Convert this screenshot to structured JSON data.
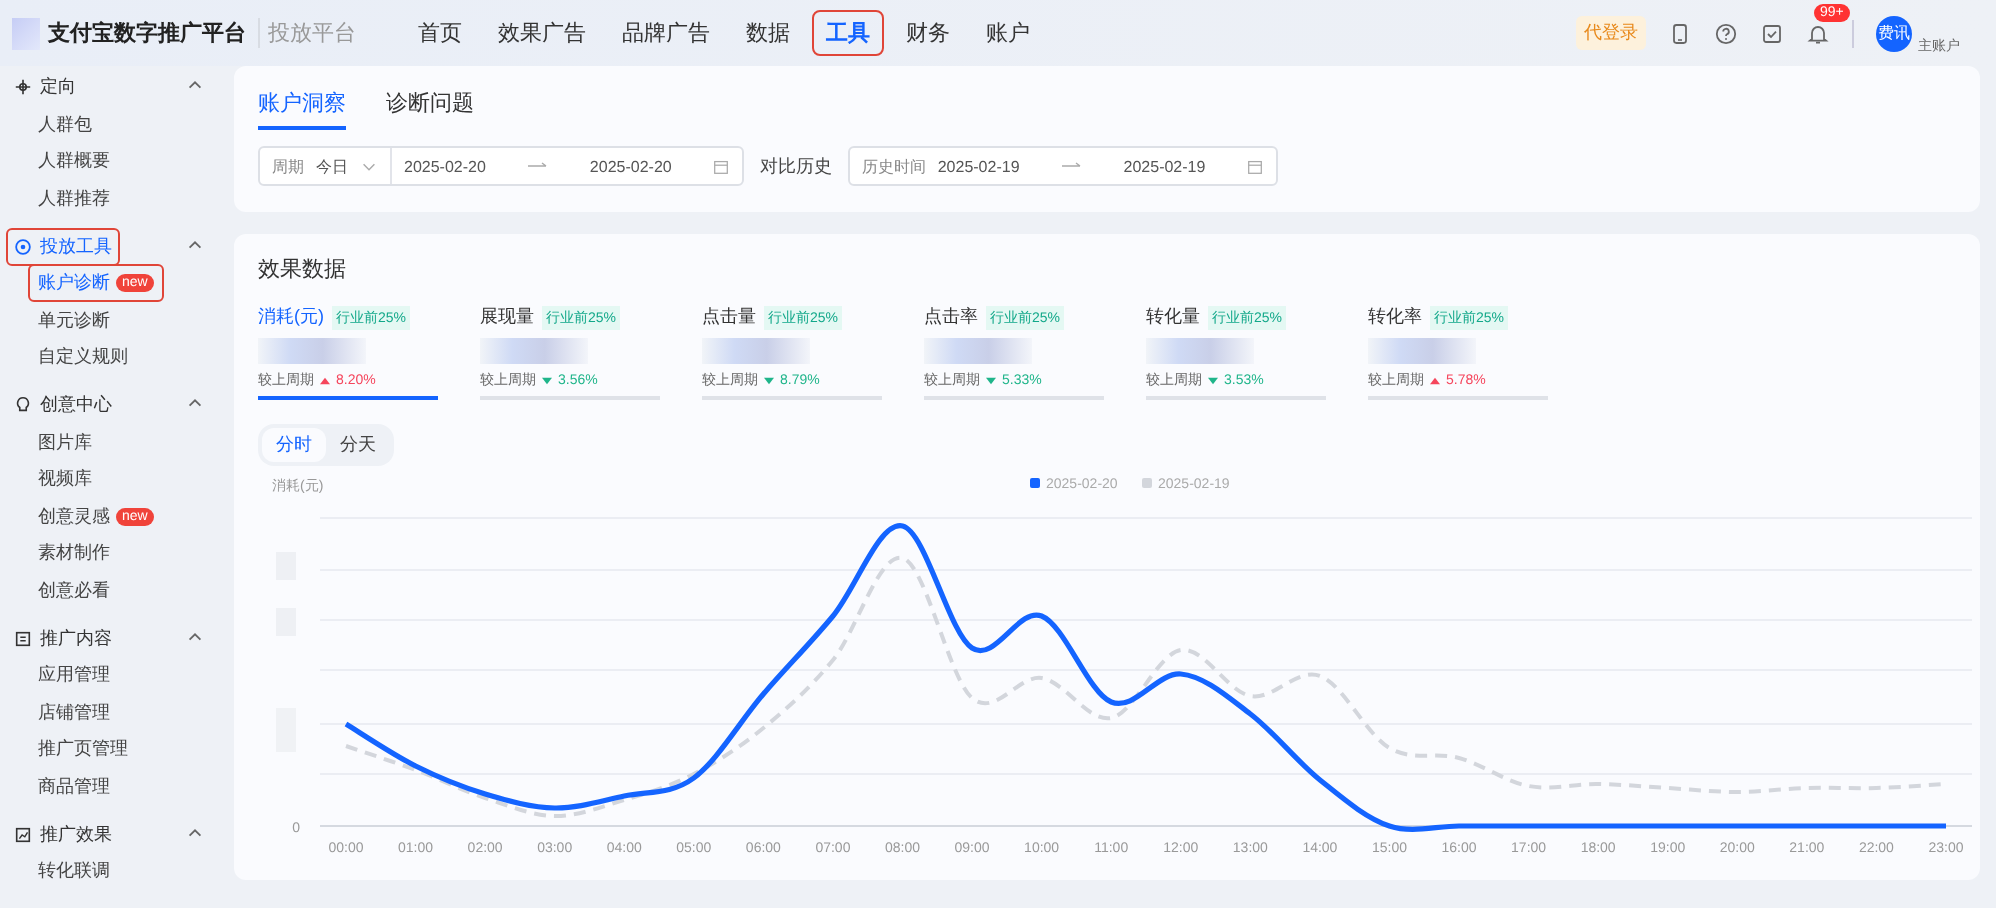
{
  "header": {
    "brand": "支付宝数字推广平台",
    "subtitle": "投放平台",
    "nav": [
      {
        "label": "首页",
        "selected": false,
        "highlighted": false
      },
      {
        "label": "效果广告",
        "selected": false,
        "highlighted": false
      },
      {
        "label": "品牌广告",
        "selected": false,
        "highlighted": false
      },
      {
        "label": "数据",
        "selected": false,
        "highlighted": false
      },
      {
        "label": "工具",
        "selected": true,
        "highlighted": true
      },
      {
        "label": "财务",
        "selected": false,
        "highlighted": false
      },
      {
        "label": "账户",
        "selected": false,
        "highlighted": false
      }
    ],
    "proxy_badge": "代登录",
    "notification_count": "99+",
    "avatar_text": "费讯",
    "account_label": "主账户"
  },
  "sidebar": [
    {
      "label": "定向",
      "kind": "target",
      "expanded": true,
      "selected": false,
      "highlighted": false,
      "children": [
        {
          "label": "人群包",
          "selected": false,
          "highlighted": false
        },
        {
          "label": "人群概要",
          "selected": false,
          "highlighted": false
        },
        {
          "label": "人群推荐",
          "selected": false,
          "highlighted": false
        }
      ]
    },
    {
      "label": "投放工具",
      "kind": "tool",
      "expanded": true,
      "selected": true,
      "highlighted": true,
      "children": [
        {
          "label": "账户诊断",
          "selected": true,
          "highlighted": true,
          "badge": "new"
        },
        {
          "label": "单元诊断",
          "selected": false,
          "highlighted": false
        },
        {
          "label": "自定义规则",
          "selected": false,
          "highlighted": false
        }
      ]
    },
    {
      "label": "创意中心",
      "kind": "creative",
      "expanded": true,
      "selected": false,
      "highlighted": false,
      "children": [
        {
          "label": "图片库",
          "selected": false,
          "highlighted": false
        },
        {
          "label": "视频库",
          "selected": false,
          "highlighted": false
        },
        {
          "label": "创意灵感",
          "selected": false,
          "highlighted": false,
          "badge": "new"
        },
        {
          "label": "素材制作",
          "selected": false,
          "highlighted": false
        },
        {
          "label": "创意必看",
          "selected": false,
          "highlighted": false
        }
      ]
    },
    {
      "label": "推广内容",
      "kind": "content",
      "expanded": true,
      "selected": false,
      "highlighted": false,
      "children": [
        {
          "label": "应用管理",
          "selected": false,
          "highlighted": false
        },
        {
          "label": "店铺管理",
          "selected": false,
          "highlighted": false
        },
        {
          "label": "推广页管理",
          "selected": false,
          "highlighted": false
        },
        {
          "label": "商品管理",
          "selected": false,
          "highlighted": false
        }
      ]
    },
    {
      "label": "推广效果",
      "kind": "effect",
      "expanded": true,
      "selected": false,
      "highlighted": false,
      "children": [
        {
          "label": "转化联调",
          "selected": false,
          "highlighted": false
        }
      ]
    }
  ],
  "tabs": [
    {
      "label": "账户洞察",
      "selected": true
    },
    {
      "label": "诊断问题",
      "selected": false
    }
  ],
  "filters": {
    "period_label": "周期",
    "period_value": "今日",
    "start": "2025-02-20",
    "end": "2025-02-20",
    "compare_label": "对比历史",
    "history_label": "历史时间",
    "history_start": "2025-02-19",
    "history_end": "2025-02-19"
  },
  "section_title": "效果数据",
  "metrics": [
    {
      "name": "消耗(元)",
      "tag": "行业前25%",
      "compare_label": "较上周期",
      "rising": true,
      "change": "8.20%",
      "selected": true
    },
    {
      "name": "展现量",
      "tag": "行业前25%",
      "compare_label": "较上周期",
      "rising": false,
      "change": "3.56%",
      "selected": false
    },
    {
      "name": "点击量",
      "tag": "行业前25%",
      "compare_label": "较上周期",
      "rising": false,
      "change": "8.79%",
      "selected": false
    },
    {
      "name": "点击率",
      "tag": "行业前25%",
      "compare_label": "较上周期",
      "rising": false,
      "change": "5.33%",
      "selected": false
    },
    {
      "name": "转化量",
      "tag": "行业前25%",
      "compare_label": "较上周期",
      "rising": false,
      "change": "3.53%",
      "selected": false
    },
    {
      "name": "转化率",
      "tag": "行业前25%",
      "compare_label": "较上周期",
      "rising": true,
      "change": "5.78%",
      "selected": false
    }
  ],
  "chart": {
    "toggles": [
      {
        "label": "分时",
        "selected": true
      },
      {
        "label": "分天",
        "selected": false
      }
    ],
    "y_label": "消耗(元)",
    "zero_label": "0",
    "legend": [
      {
        "label": "2025-02-20",
        "color": "#1464ff"
      },
      {
        "label": "2025-02-19",
        "color": "#d3d6dc"
      }
    ],
    "x_labels": [
      "00:00",
      "01:00",
      "02:00",
      "03:00",
      "04:00",
      "05:00",
      "06:00",
      "07:00",
      "08:00",
      "09:00",
      "10:00",
      "11:00",
      "12:00",
      "13:00",
      "14:00",
      "15:00",
      "16:00",
      "17:00",
      "18:00",
      "19:00",
      "20:00",
      "21:00",
      "22:00",
      "23:00"
    ]
  }
}
